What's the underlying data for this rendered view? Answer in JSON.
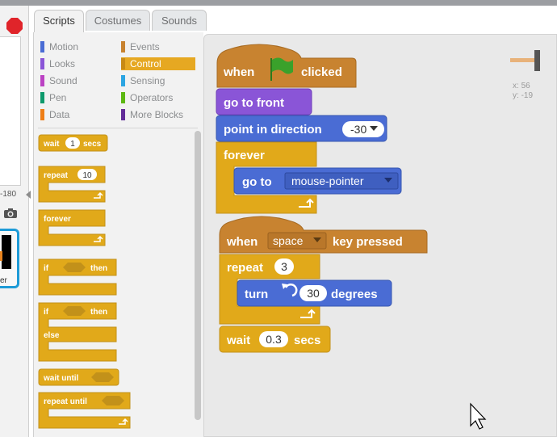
{
  "tabs": [
    {
      "label": "Scripts"
    },
    {
      "label": "Costumes"
    },
    {
      "label": "Sounds"
    }
  ],
  "stage": {
    "coord_left": "-180",
    "sprite_label": "er"
  },
  "categories": [
    {
      "label": "Motion",
      "color": "#4a6cd4"
    },
    {
      "label": "Looks",
      "color": "#8a55d7"
    },
    {
      "label": "Sound",
      "color": "#bb42c3"
    },
    {
      "label": "Pen",
      "color": "#0e9a6c"
    },
    {
      "label": "Data",
      "color": "#ee7d16"
    },
    {
      "label": "Events",
      "color": "#c88330"
    },
    {
      "label": "Control",
      "color": "#e1a91a",
      "selected": true
    },
    {
      "label": "Sensing",
      "color": "#2ca5e2"
    },
    {
      "label": "Operators",
      "color": "#5cb712"
    },
    {
      "label": "More Blocks",
      "color": "#632d99"
    }
  ],
  "palette": {
    "wait": {
      "pre": "wait",
      "value": "1",
      "post": "secs"
    },
    "repeat": {
      "pre": "repeat",
      "value": "10"
    },
    "forever": {
      "label": "forever"
    },
    "if_then": {
      "pre": "if",
      "post": "then"
    },
    "if_else": {
      "pre": "if",
      "post": "then",
      "else": "else"
    },
    "wait_until": {
      "label": "wait until"
    },
    "repeat_until": {
      "label": "repeat until"
    }
  },
  "script1": {
    "hat": {
      "pre": "when",
      "post": "clicked"
    },
    "go_front": "go to front",
    "point": {
      "label": "point in direction",
      "value": "-30"
    },
    "forever": "forever",
    "goto": {
      "label": "go to",
      "value": "mouse-pointer"
    }
  },
  "script2": {
    "hat": {
      "pre": "when",
      "value": "space",
      "post": "key pressed"
    },
    "repeat": {
      "label": "repeat",
      "value": "3"
    },
    "turn": {
      "pre": "turn",
      "value": "30",
      "post": "degrees"
    },
    "wait": {
      "pre": "wait",
      "value": "0.3",
      "post": "secs"
    }
  },
  "sprite_info": {
    "x_label": "x:",
    "x_value": "56",
    "y_label": "y:",
    "y_value": "-19"
  },
  "colors": {
    "control": "#e1a91a",
    "control_dark": "#c2911a",
    "events": "#c88330",
    "motion": "#4a6cd4",
    "looks": "#8a55d7",
    "flag": "#3aa12b"
  }
}
